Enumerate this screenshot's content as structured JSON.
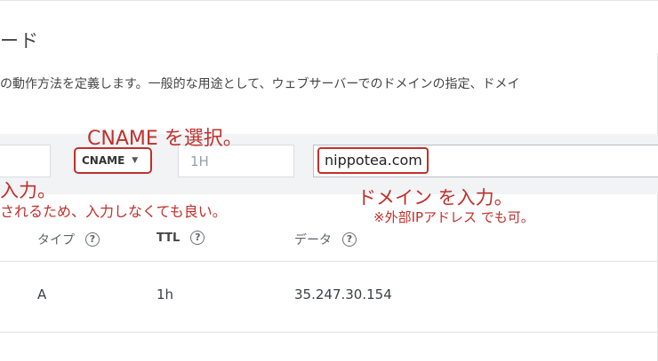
{
  "heading": "ード",
  "description": "の動作方法を定義します。一般的な用途として、ウェブサーバーでのドメインの指定、ドメイ",
  "form": {
    "type_value": "CNAME",
    "ttl_placeholder": "1H",
    "data_value": "nippotea.com"
  },
  "annotations": {
    "select_cname": "CNAME を選択。",
    "name_input": "入力。",
    "name_note": "されるため、入力しなくても良い。",
    "domain_input": "ドメイン を入力。",
    "domain_note": "※外部IPアドレス でも可。"
  },
  "table": {
    "headers": {
      "type": "タイプ",
      "ttl": "TTL",
      "data": "データ"
    },
    "rows": [
      {
        "type": "A",
        "ttl": "1h",
        "data": "35.247.30.154"
      }
    ]
  },
  "icons": {
    "help": "help-circle-icon"
  },
  "colors": {
    "annotation": "#c0302c",
    "band": "#f1f3f4"
  }
}
